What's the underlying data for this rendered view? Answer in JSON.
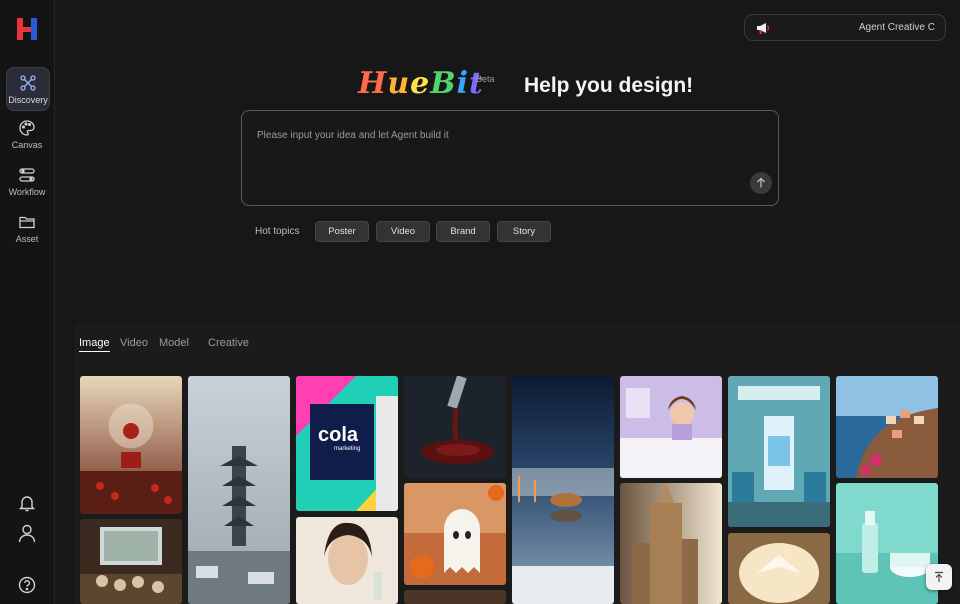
{
  "app": {
    "brand_wordmark": "HueBit",
    "beta_badge": "Beta",
    "headline": "Help you design!"
  },
  "sidebar": {
    "items": [
      {
        "label": "Discovery",
        "icon": "discovery-icon",
        "active": true
      },
      {
        "label": "Canvas",
        "icon": "palette-icon",
        "active": false
      },
      {
        "label": "Workflow",
        "icon": "workflow-icon",
        "active": false
      },
      {
        "label": "Asset",
        "icon": "folder-icon",
        "active": false
      }
    ],
    "bottom_icons": [
      "bell-icon",
      "user-icon",
      "help-icon"
    ]
  },
  "agent": {
    "label": "Agent Creative C",
    "icon": "megaphone-icon"
  },
  "prompt": {
    "placeholder": "Please input your idea and let Agent build it",
    "value": ""
  },
  "hot_topics": {
    "label": "Hot topics",
    "chips": [
      "Poster",
      "Video",
      "Brand",
      "Story"
    ]
  },
  "gallery": {
    "tabs": [
      {
        "label": "Image",
        "active": true
      },
      {
        "label": "Video",
        "active": false
      },
      {
        "label": "Model",
        "active": false
      },
      {
        "label": "Creative",
        "active": false
      }
    ],
    "cola_card_text": "cola",
    "cola_card_subtext": "marketing"
  },
  "colors": {
    "background": "#171717",
    "sidebar": "#141414",
    "active_nav": "#2a2d38",
    "logo_red": "#e8343a",
    "logo_blue": "#2d5bd8"
  }
}
